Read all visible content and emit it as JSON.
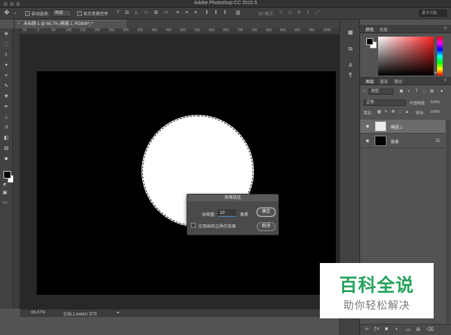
{
  "window": {
    "title": "Adobe Photoshop CC 2015.5"
  },
  "options_bar": {
    "auto_select_label": "自动选择:",
    "auto_select_target": "图层",
    "show_transform_label": "显示变换控件",
    "mode_3d_label": "3D 模式:",
    "workspace": "基本功能"
  },
  "document_tab": {
    "close_glyph": "×",
    "title": "未标题-1 @ 66.7% (椭圆 1, RGB/8*) *"
  },
  "ruler": {
    "ticks": [
      "50",
      "0",
      "50",
      "100",
      "150",
      "200",
      "250",
      "300",
      "350",
      "400",
      "450",
      "500",
      "550",
      "600",
      "650",
      "700",
      "750",
      "800",
      "850",
      "900",
      "950",
      "1000"
    ]
  },
  "dialog": {
    "title": "收缩选区",
    "field_label": "收缩量:",
    "field_value": "10",
    "unit": "像素",
    "checkbox_label": "应用画布边界的效果",
    "ok_label": "确定",
    "cancel_label": "取消"
  },
  "status_bar": {
    "zoom": "66.67%",
    "doc_info": "文档:2.94M/0 字节",
    "arrow": "▸"
  },
  "color_panel": {
    "tabs": [
      "颜色",
      "色板"
    ]
  },
  "layers_panel": {
    "tabs": [
      "图层",
      "通道",
      "路径"
    ],
    "filter_label": "类型",
    "blend_mode": "正常",
    "opacity_label": "不透明度:",
    "opacity_value": "100%",
    "lock_label": "锁定:",
    "fill_label": "填充:",
    "fill_value": "100%",
    "layers": [
      {
        "name": "椭圆 1",
        "selected": true
      },
      {
        "name": "背景",
        "selected": false
      }
    ]
  },
  "watermark": {
    "main": "百科全说",
    "sub": "助你轻松解决"
  },
  "colors": {
    "canvas": "#000000",
    "selection_fill": "#ffffff",
    "watermark_green": "#25a35c"
  }
}
